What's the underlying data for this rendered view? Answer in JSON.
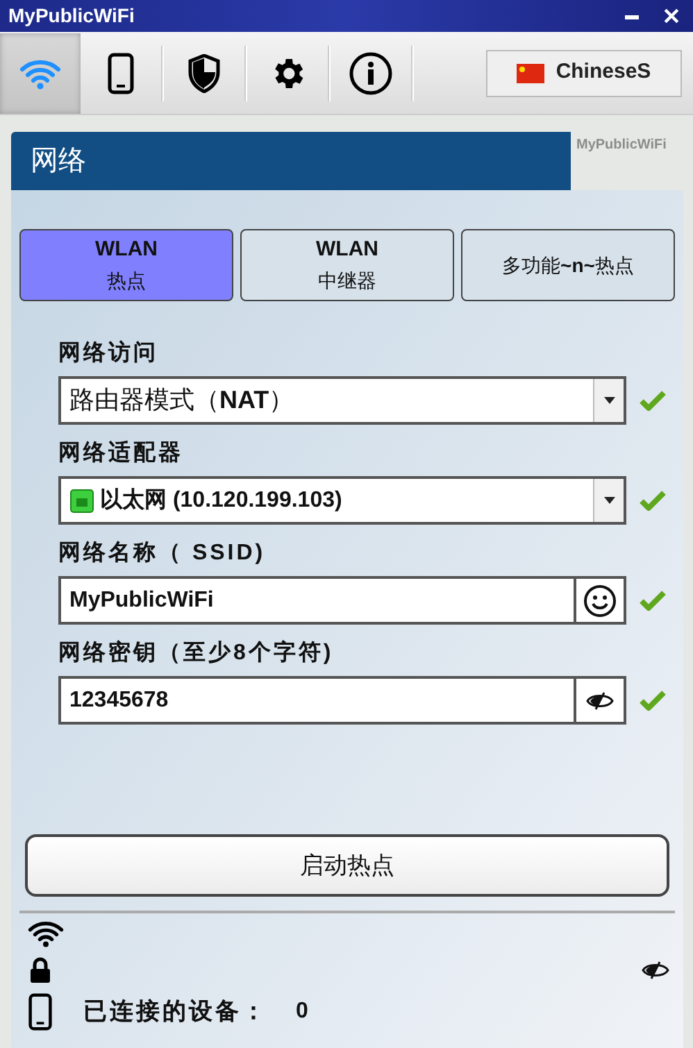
{
  "window": {
    "title": "MyPublicWiFi"
  },
  "toolbar": {
    "tabs": [
      {
        "kind": "wifi",
        "selected": true
      },
      {
        "kind": "phone",
        "selected": false
      },
      {
        "kind": "shield",
        "selected": false
      },
      {
        "kind": "gear",
        "selected": false
      },
      {
        "kind": "info",
        "selected": false
      }
    ],
    "language": "ChineseS"
  },
  "panel": {
    "title": "网络",
    "brand": "MyPublicWiFi"
  },
  "modes": [
    {
      "title": "WLAN",
      "label": "热点",
      "selected": true
    },
    {
      "title": "WLAN",
      "label": "中继器",
      "selected": false
    },
    {
      "label": "多功能**~n~**热点",
      "selected": false
    }
  ],
  "fields": [
    {
      "kind": "dropdown",
      "label": "网络访问",
      "value": "路由器模式（**NAT**）",
      "valid": true
    },
    {
      "kind": "adapter",
      "label": "网络适配器",
      "value": "以太网 (10.120.199.103)",
      "valid": true
    },
    {
      "kind": "ssid",
      "label": "网络名称（ SSID)",
      "value": "MyPublicWiFi",
      "valid": true
    },
    {
      "kind": "password",
      "label": "网络密钥（至少8个字符)",
      "value": "12345678",
      "valid": true
    }
  ],
  "start_button": "启动热点",
  "status": {
    "connected_label": "已连接的设备：",
    "connected_count": "0"
  }
}
